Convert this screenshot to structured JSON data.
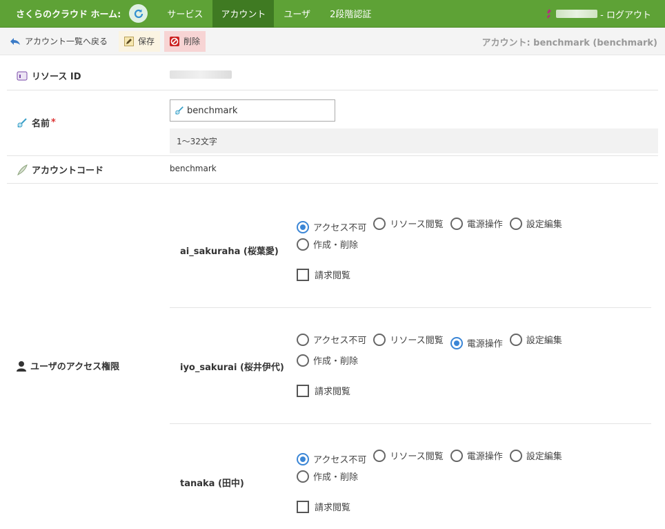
{
  "header": {
    "brand": "さくらのクラウド ホーム:",
    "nav": [
      "サービス",
      "アカウント",
      "ユーザ",
      "2段階認証"
    ],
    "active_index": 1,
    "logout": "- ログアウト"
  },
  "toolbar": {
    "back": "アカウント一覧へ戻る",
    "save": "保存",
    "delete": "削除",
    "title": "アカウント: benchmark (benchmark)"
  },
  "form": {
    "resource_id_label": "リソース ID",
    "name_label": "名前",
    "name_required": "*",
    "name_value": "benchmark",
    "name_hint": "1〜32文字",
    "account_code_label": "アカウントコード",
    "account_code_value": "benchmark",
    "access_label": "ユーザのアクセス権限"
  },
  "permission_options": [
    "アクセス不可",
    "リソース閲覧",
    "電源操作",
    "設定編集",
    "作成・削除"
  ],
  "billing_label": "請求閲覧",
  "users": [
    {
      "name": "ai_sakuraha (桜葉愛)",
      "selected": "アクセス不可",
      "billing": false
    },
    {
      "name": "iyo_sakurai (桜井伊代)",
      "selected": "電源操作",
      "billing": false
    },
    {
      "name": "tanaka (田中)",
      "selected": "アクセス不可",
      "billing": false
    }
  ],
  "colors": {
    "topbar": "#5ea236",
    "active_tab": "#3f7a22",
    "radio_on": "#3b86d6"
  }
}
